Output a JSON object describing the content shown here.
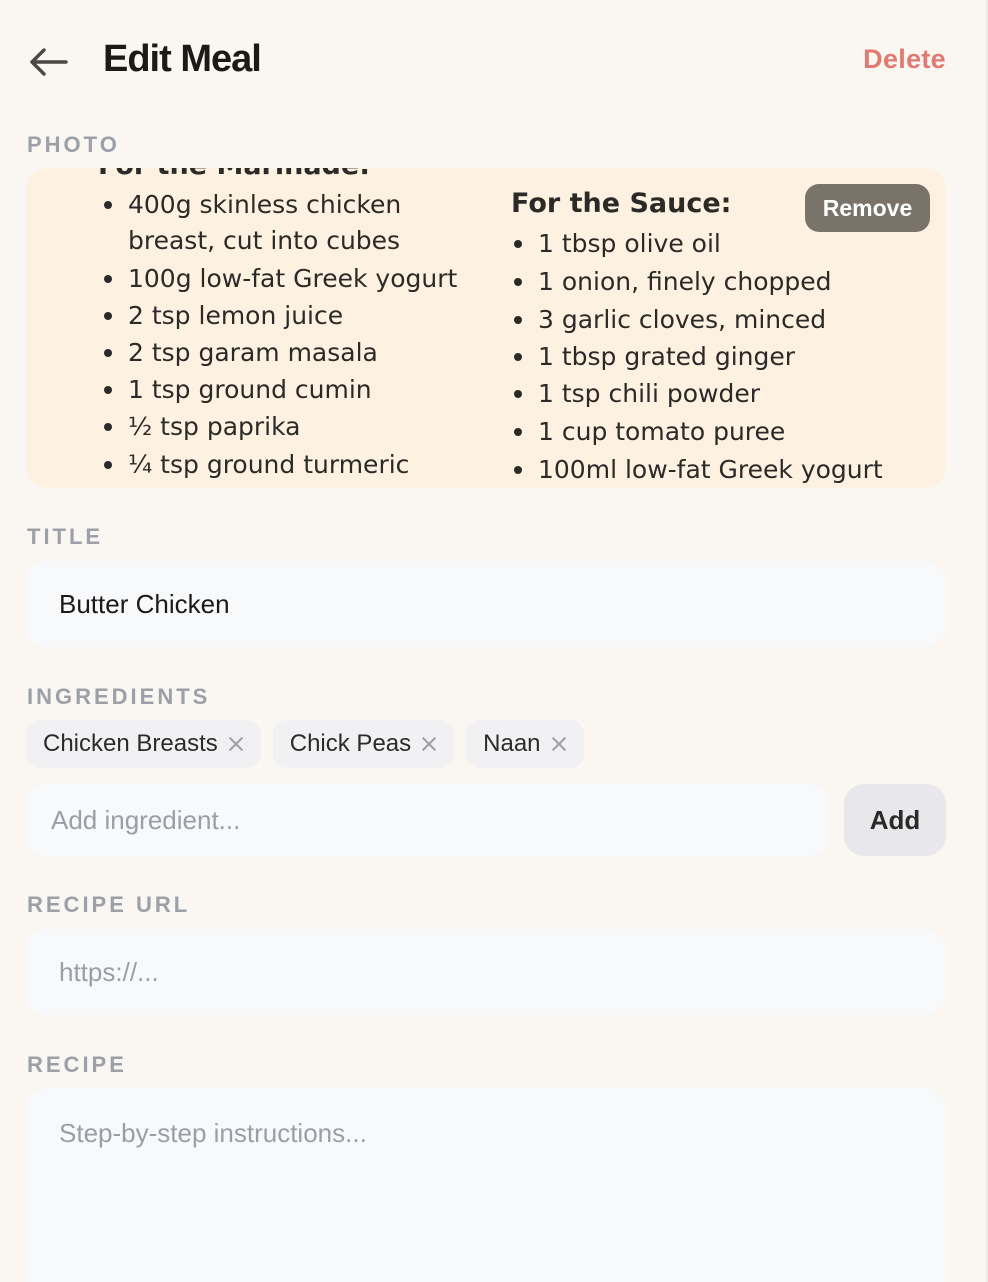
{
  "header": {
    "title": "Edit Meal",
    "delete_label": "Delete",
    "back_icon": "arrow-left-icon"
  },
  "photo": {
    "label": "Photo",
    "remove_label": "Remove",
    "image_text": {
      "marinade_heading": "For the Marinade:",
      "marinade_items": [
        "400g skinless chicken",
        "breast, cut into cubes",
        "100g low-fat Greek yogurt",
        "2 tsp lemon juice",
        "2 tsp garam masala",
        "1 tsp ground cumin",
        "½ tsp paprika",
        "¼ tsp ground turmeric"
      ],
      "sauce_heading": "For the Sauce:",
      "sauce_items": [
        "1 tbsp olive oil",
        "1 onion, finely chopped",
        "3 garlic cloves, minced",
        "1 tbsp grated ginger",
        "1 tsp chili powder",
        "1 cup tomato puree",
        "100ml low-fat Greek yogurt"
      ]
    }
  },
  "title_section": {
    "label": "Title",
    "value": "Butter Chicken"
  },
  "ingredients": {
    "label": "Ingredients",
    "chips": [
      "Chicken Breasts",
      "Chick Peas",
      "Naan"
    ],
    "input_placeholder": "Add ingredient...",
    "add_label": "Add"
  },
  "recipe_url": {
    "label": "Recipe URL",
    "placeholder": "https://..."
  },
  "recipe": {
    "label": "Recipe",
    "placeholder": "Step-by-step instructions..."
  },
  "colors": {
    "background": "#faf6f1",
    "delete": "#e07a72",
    "label": "#9ca0a8",
    "field": "#f8f9fb"
  }
}
